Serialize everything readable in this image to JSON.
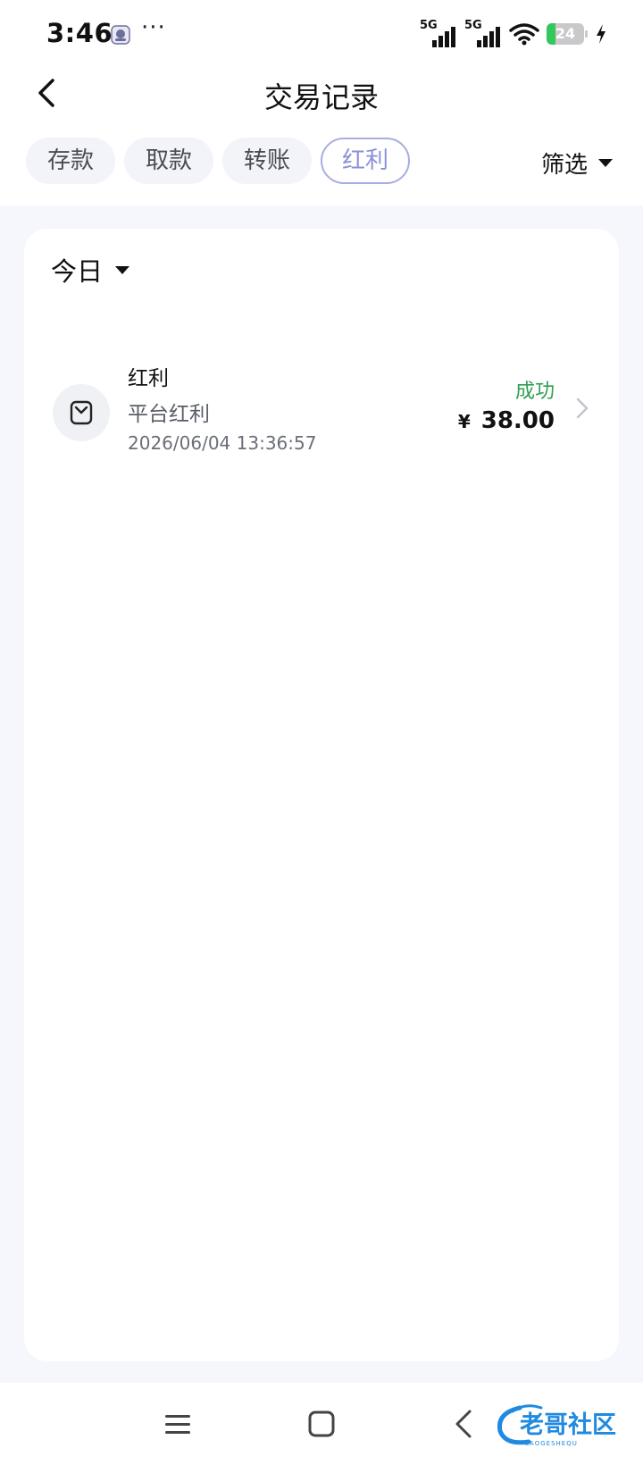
{
  "status_bar": {
    "time": "3:46",
    "more": "···",
    "signal_1": "5G",
    "signal_2": "5G",
    "battery_level": 24,
    "battery_label": "24",
    "charging": true
  },
  "header": {
    "title": "交易记录"
  },
  "tabs": [
    {
      "label": "存款",
      "active": false
    },
    {
      "label": "取款",
      "active": false
    },
    {
      "label": "转账",
      "active": false
    },
    {
      "label": "红利",
      "active": true
    }
  ],
  "filter": {
    "label": "筛选"
  },
  "date_filter": {
    "label": "今日"
  },
  "transactions": [
    {
      "type": "红利",
      "description": "平台红利",
      "time": "2026/06/04 13:36:57",
      "status": "成功",
      "currency": "¥",
      "amount": "38.00"
    }
  ],
  "colors": {
    "accent": "#8b91d6",
    "success": "#2f9e52",
    "background": "#f6f7fc"
  },
  "watermark": {
    "text": "老哥社区",
    "subtext": "LAOGESHEQU"
  }
}
